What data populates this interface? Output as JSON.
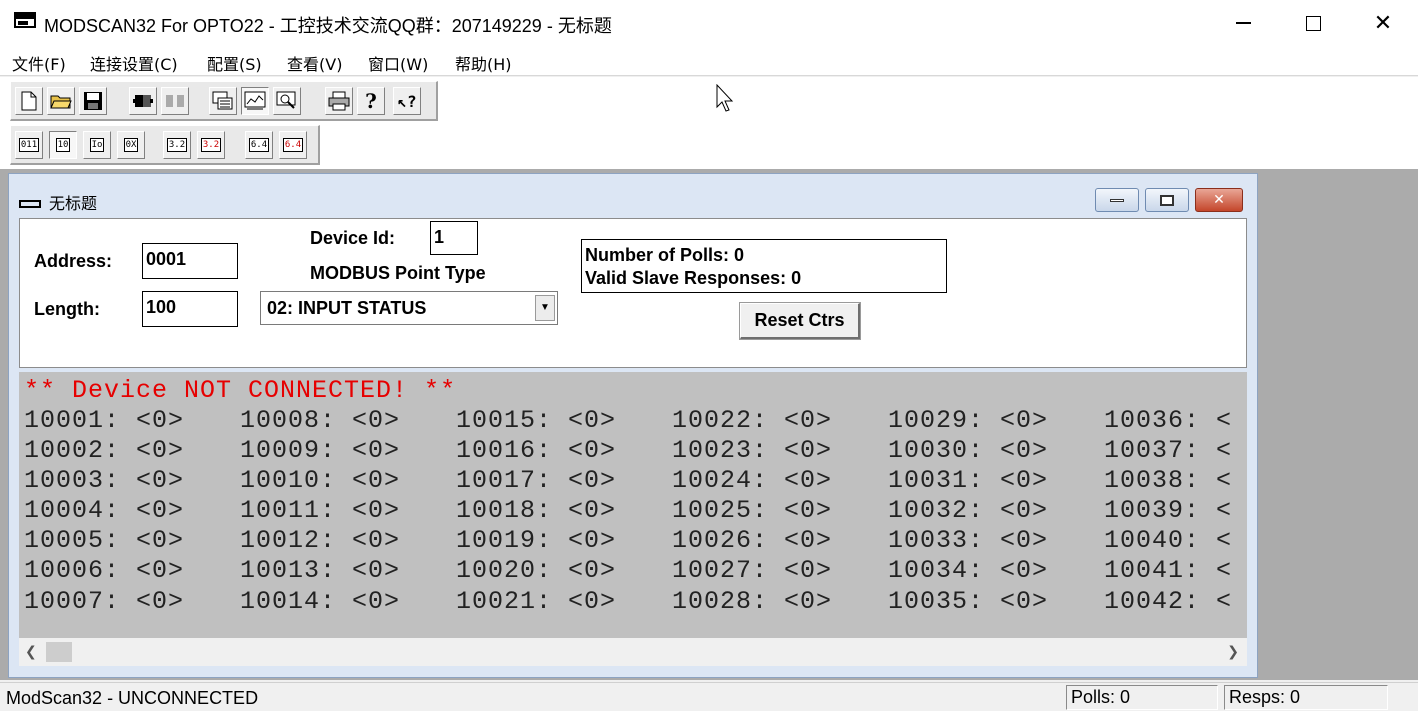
{
  "window": {
    "title": "MODSCAN32 For OPTO22 - 工控技术交流QQ群：207149229 - 无标题"
  },
  "menu": [
    {
      "label": "文件(F)"
    },
    {
      "label": "连接设置(C)"
    },
    {
      "label": "配置(S)"
    },
    {
      "label": "查看(V)"
    },
    {
      "label": "窗口(W)"
    },
    {
      "label": "帮助(H)"
    }
  ],
  "toolbar1": [
    {
      "icon": "new-document-icon"
    },
    {
      "icon": "open-folder-icon"
    },
    {
      "icon": "save-icon"
    },
    {
      "icon": "connect-icon"
    },
    {
      "icon": "disconnect-icon"
    },
    {
      "icon": "display-format-icon"
    },
    {
      "icon": "trend-chart-icon"
    },
    {
      "icon": "tag-view-icon"
    },
    {
      "icon": "print-icon"
    },
    {
      "icon": "help-icon"
    },
    {
      "icon": "context-help-icon"
    }
  ],
  "toolbar2": [
    {
      "label": "011",
      "icon": "binary-format-icon"
    },
    {
      "label": "10",
      "icon": "decimal-format-icon"
    },
    {
      "label": "Io",
      "icon": "integer-format-icon"
    },
    {
      "label": "0X",
      "icon": "hex-format-icon"
    },
    {
      "label": "3.2",
      "icon": "float-format-icon"
    },
    {
      "label": "3.2",
      "icon": "float-swapped-format-icon"
    },
    {
      "label": "6.4",
      "icon": "double-format-icon"
    },
    {
      "label": "6.4",
      "icon": "double-swapped-format-icon"
    }
  ],
  "child": {
    "title": "无标题",
    "address_label": "Address:",
    "address_value": "0001",
    "length_label": "Length:",
    "length_value": "100",
    "device_id_label": "Device Id:",
    "device_id_value": "1",
    "point_type_label": "MODBUS Point Type",
    "point_type_value": "02: INPUT STATUS",
    "polls_text": "Number of Polls: 0",
    "responses_text": "Valid Slave Responses: 0",
    "reset_label": "Reset Ctrs",
    "status_line": "** Device NOT CONNECTED! **"
  },
  "data_columns": [
    [
      "10001: <0>",
      "10002: <0>",
      "10003: <0>",
      "10004: <0>",
      "10005: <0>",
      "10006: <0>",
      "10007: <0>"
    ],
    [
      "10008: <0>",
      "10009: <0>",
      "10010: <0>",
      "10011: <0>",
      "10012: <0>",
      "10013: <0>",
      "10014: <0>"
    ],
    [
      "10015: <0>",
      "10016: <0>",
      "10017: <0>",
      "10018: <0>",
      "10019: <0>",
      "10020: <0>",
      "10021: <0>"
    ],
    [
      "10022: <0>",
      "10023: <0>",
      "10024: <0>",
      "10025: <0>",
      "10026: <0>",
      "10027: <0>",
      "10028: <0>"
    ],
    [
      "10029: <0>",
      "10030: <0>",
      "10031: <0>",
      "10032: <0>",
      "10033: <0>",
      "10034: <0>",
      "10035: <0>"
    ],
    [
      "10036: <",
      "10037: <",
      "10038: <",
      "10039: <",
      "10040: <",
      "10041: <",
      "10042: <"
    ]
  ],
  "statusbar": {
    "text": "ModScan32 - UNCONNECTED",
    "polls": "Polls: 0",
    "resps": "Resps: 0"
  }
}
